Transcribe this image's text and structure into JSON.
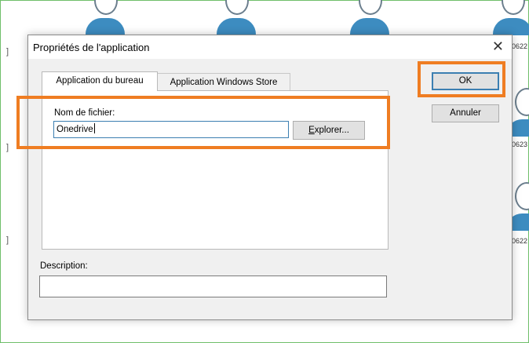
{
  "background": {
    "side_labels": [
      "0622",
      "0623",
      "0622"
    ],
    "bracket_glyph": "]"
  },
  "dialog": {
    "title": "Propriétés de l'application",
    "close_glyph": "✕",
    "tabs": [
      {
        "label": "Application du bureau",
        "active": true
      },
      {
        "label": "Application Windows Store",
        "active": false
      }
    ],
    "filename_label": "Nom de fichier:",
    "filename_value": "Onedrive",
    "browse_label": "Explorer...",
    "description_label": "Description:",
    "description_value": "",
    "ok_label": "OK",
    "cancel_label": "Annuler"
  },
  "highlights": {
    "color": "#ef7d22",
    "targets": [
      "filename-section",
      "ok-button"
    ]
  }
}
